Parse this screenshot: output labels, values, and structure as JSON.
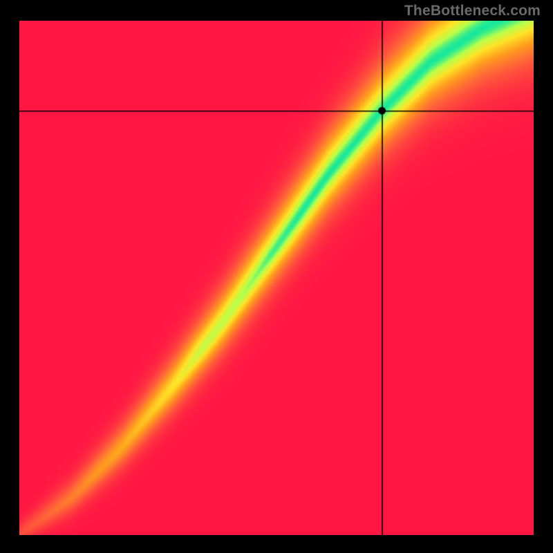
{
  "watermark": "TheBottleneck.com",
  "chart_data": {
    "type": "heatmap",
    "title": "",
    "xlabel": "",
    "ylabel": "",
    "xlim": [
      0,
      1
    ],
    "ylim": [
      0,
      1
    ],
    "marker": {
      "x": 0.705,
      "y": 0.825
    },
    "crosshair": {
      "x": 0.705,
      "y": 0.825
    },
    "ridge": {
      "description": "Green optimal band along a super-linear diagonal",
      "points": [
        {
          "x": 0.0,
          "y": 0.0
        },
        {
          "x": 0.1,
          "y": 0.07
        },
        {
          "x": 0.2,
          "y": 0.17
        },
        {
          "x": 0.3,
          "y": 0.29
        },
        {
          "x": 0.4,
          "y": 0.42
        },
        {
          "x": 0.5,
          "y": 0.56
        },
        {
          "x": 0.6,
          "y": 0.7
        },
        {
          "x": 0.7,
          "y": 0.82
        },
        {
          "x": 0.8,
          "y": 0.92
        },
        {
          "x": 0.9,
          "y": 0.985
        },
        {
          "x": 1.0,
          "y": 1.03
        }
      ],
      "band_half_width": 0.05
    },
    "colorscale": [
      {
        "t": 0.0,
        "hex": "#ff1744"
      },
      {
        "t": 0.3,
        "hex": "#ff5e3a"
      },
      {
        "t": 0.55,
        "hex": "#ff9f1e"
      },
      {
        "t": 0.75,
        "hex": "#ffe326"
      },
      {
        "t": 0.9,
        "hex": "#b7ff4a"
      },
      {
        "t": 1.0,
        "hex": "#17e89b"
      }
    ],
    "corner_bias": {
      "bottom_left_pull_to_red": 0.9,
      "bottom_right_pull_to_red": 1.0,
      "top_left_pull_to_red": 0.65
    }
  }
}
